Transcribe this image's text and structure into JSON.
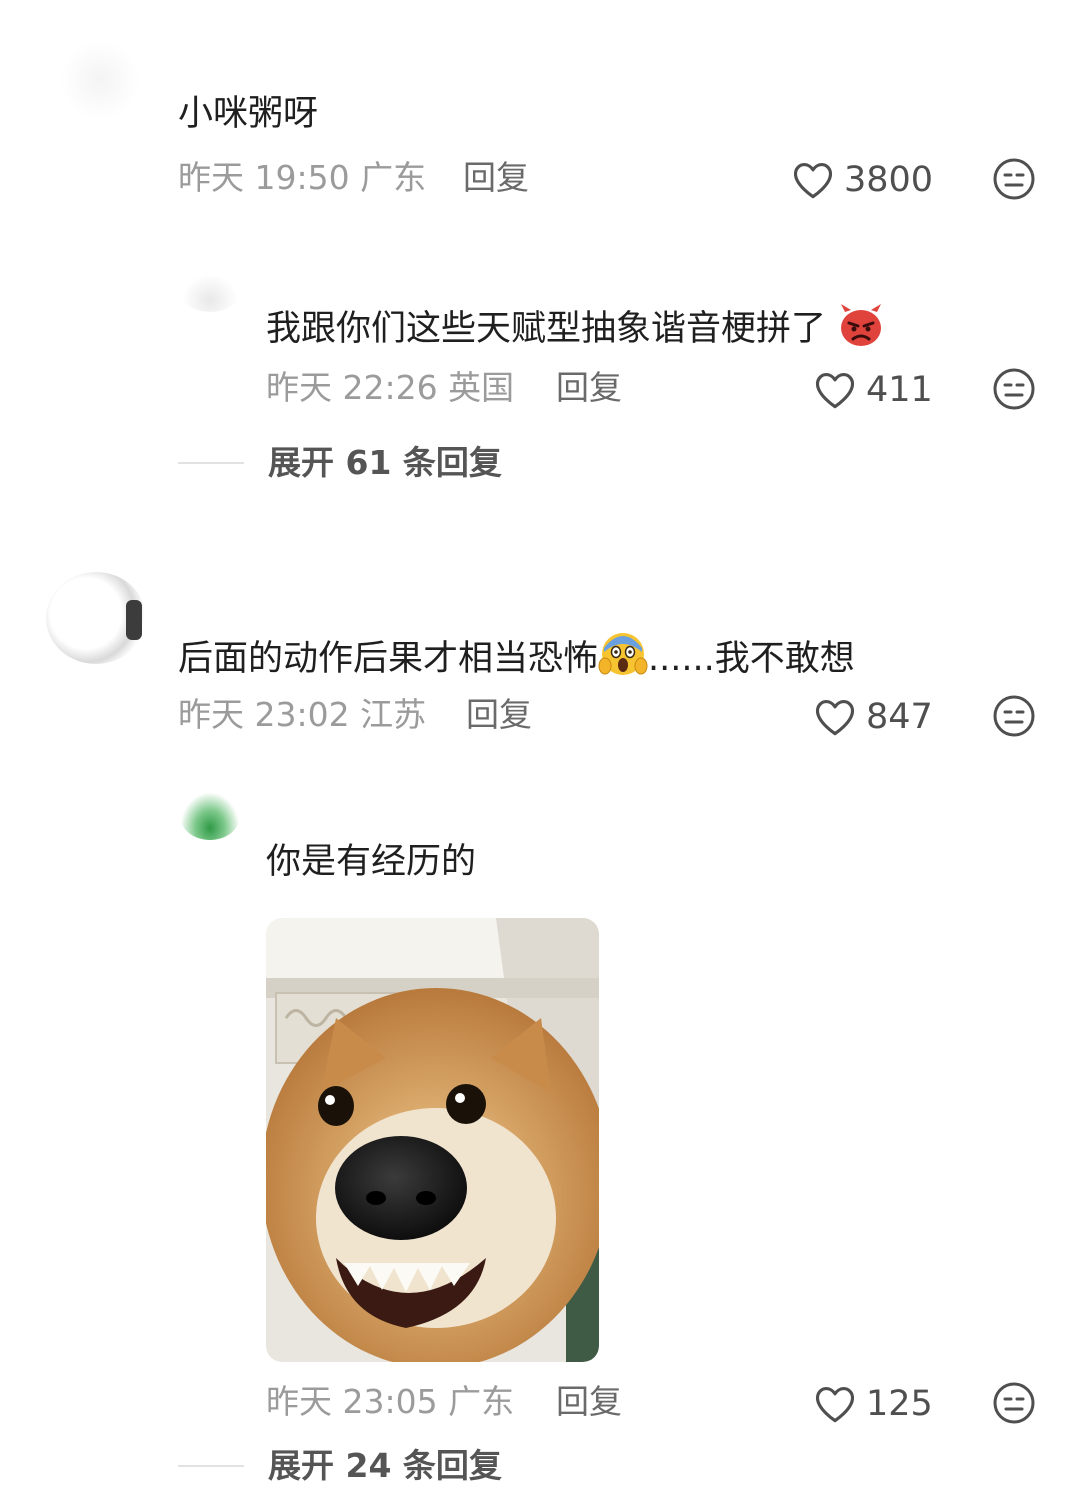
{
  "comments": [
    {
      "text": "小咪粥呀",
      "time": "昨天 19:50",
      "location": "广东",
      "reply_label": "回复",
      "likes": "3800"
    },
    {
      "text": "我跟你们这些天赋型抽象谐音梗拼了",
      "emoji": "angry-devil-emoji",
      "time": "昨天 22:26",
      "location": "英国",
      "reply_label": "回复",
      "likes": "411",
      "expand_label": "展开 61 条回复"
    },
    {
      "text_before": "后面的动作后果才相当恐怖",
      "emoji": "screaming-face-emoji",
      "text_after": "......我不敢想",
      "time": "昨天 23:02",
      "location": "江苏",
      "reply_label": "回复",
      "likes": "847"
    },
    {
      "text": "你是有经历的",
      "image": "grinning-dog-photo",
      "time": "昨天 23:05",
      "location": "广东",
      "reply_label": "回复",
      "likes": "125",
      "expand_label": "展开 24 条回复"
    }
  ],
  "colors": {
    "background": "#ffffff",
    "body_text": "#1f1f1f",
    "meta_text": "#9b9b9b",
    "icon": "#4f4f4f"
  }
}
